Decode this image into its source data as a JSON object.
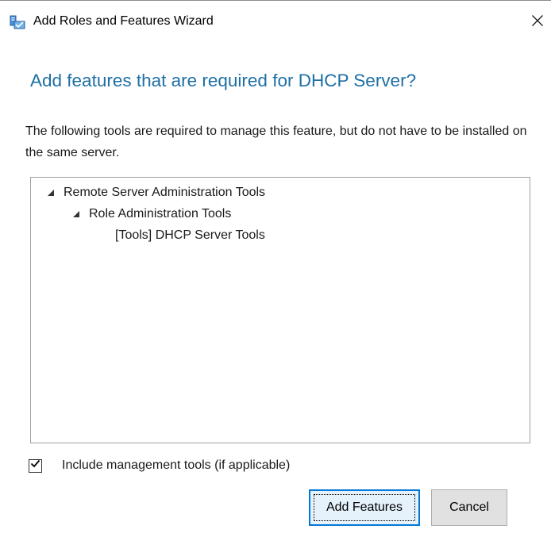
{
  "window": {
    "title": "Add Roles and Features Wizard",
    "icon": "server-manager-icon",
    "close_glyph": "✕"
  },
  "heading": "Add features that are required for DHCP Server?",
  "description": "The following tools are required to manage this feature, but do not have to be installed on the same server.",
  "tree": {
    "items": [
      {
        "label": "Remote Server Administration Tools",
        "expander": "◢",
        "expanded": true
      },
      {
        "label": "Role Administration Tools",
        "expander": "◢",
        "expanded": true
      },
      {
        "label": "[Tools] DHCP Server Tools"
      }
    ]
  },
  "include_tools": {
    "label": "Include management tools (if applicable)",
    "checked": true
  },
  "buttons": {
    "add_features": "Add Features",
    "cancel": "Cancel"
  },
  "colors": {
    "heading": "#1e6fa5",
    "focus_border": "#0078d7",
    "button_face": "#e1e1e1"
  }
}
